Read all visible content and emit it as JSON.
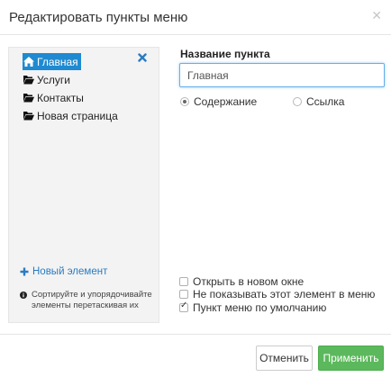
{
  "dialog": {
    "title": "Редактировать пункты меню",
    "close_icon": "close-icon"
  },
  "tree": {
    "items": [
      {
        "label": "Главная",
        "icon": "home-icon",
        "selected": true
      },
      {
        "label": "Услуги",
        "icon": "folder-open-icon",
        "selected": false
      },
      {
        "label": "Контакты",
        "icon": "folder-open-icon",
        "selected": false
      },
      {
        "label": "Новая страница",
        "icon": "folder-open-icon",
        "selected": false
      }
    ],
    "remove_icon": "remove-x-icon"
  },
  "sidebar": {
    "add_label": "Новый элемент",
    "hint_text": "Сортируйте и упорядочивайте элементы перетаскивая их"
  },
  "form": {
    "name_label": "Название пункта",
    "name_value": "Главная",
    "radio_content": "Содержание",
    "radio_link": "Ссылка",
    "radio_selected": "content",
    "opt_new_window": "Открыть в новом окне",
    "opt_hide": "Не показывать этот элемент в меню",
    "opt_default": "Пункт меню по умолчанию",
    "opt_new_window_checked": false,
    "opt_hide_checked": false,
    "opt_default_checked": true
  },
  "footer": {
    "cancel_label": "Отменить",
    "apply_label": "Применить"
  },
  "colors": {
    "accent": "#1f8ad1",
    "apply_green": "#5cb85c",
    "link_blue": "#2a7bc0"
  }
}
